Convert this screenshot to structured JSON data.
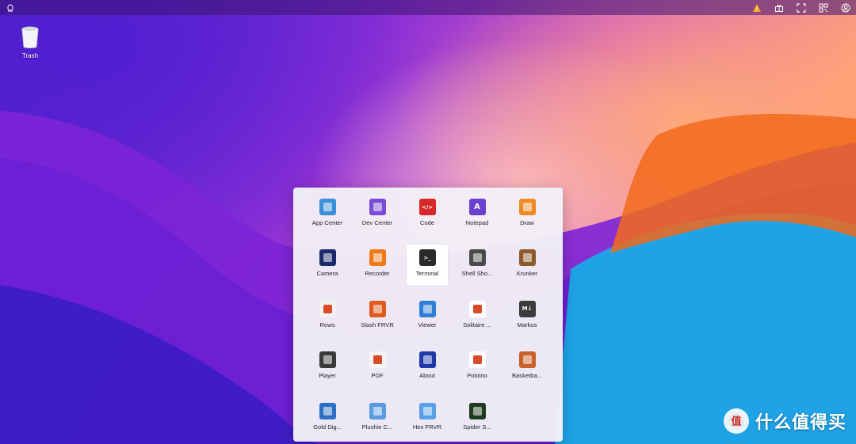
{
  "topbar": {
    "left_icon": "os-logo-icon",
    "right_icons": [
      "warning-icon",
      "gift-icon",
      "fullscreen-icon",
      "qr-code-icon",
      "user-icon"
    ]
  },
  "desktop": {
    "icons": [
      {
        "label": "Trash",
        "icon": "trash-icon"
      }
    ]
  },
  "launcher": {
    "apps": [
      {
        "label": "App Center",
        "icon": "app-center-icon",
        "color": "#3a8fd8"
      },
      {
        "label": "Dev Center",
        "icon": "dev-center-icon",
        "color": "#7a4bd6"
      },
      {
        "label": "Code",
        "icon": "code-icon",
        "color": "#d62828",
        "glyph": "</>"
      },
      {
        "label": "Notepad",
        "icon": "notepad-icon",
        "color": "#6b3fd0",
        "glyph": "A"
      },
      {
        "label": "Draw",
        "icon": "draw-icon",
        "color": "#f08a24"
      },
      {
        "label": "Camera",
        "icon": "camera-icon",
        "color": "#1b2a6b"
      },
      {
        "label": "Recorder",
        "icon": "recorder-icon",
        "color": "#f07a1a"
      },
      {
        "label": "Terminal",
        "icon": "terminal-icon",
        "color": "#2b2b2b",
        "glyph": ">_"
      },
      {
        "label": "Shell Sho...",
        "icon": "shell-shockers-icon",
        "color": "#4a4a4a"
      },
      {
        "label": "Krunker",
        "icon": "krunker-icon",
        "color": "#8a5a2a"
      },
      {
        "label": "Rows",
        "icon": "rows-icon",
        "color": "#f1f1f1"
      },
      {
        "label": "Slash FRVR",
        "icon": "slash-frvr-icon",
        "color": "#e05a1c"
      },
      {
        "label": "Viewer",
        "icon": "viewer-icon",
        "color": "#2f7fd8"
      },
      {
        "label": "Solitaire ...",
        "icon": "solitaire-icon",
        "color": "#ffffff"
      },
      {
        "label": "Markus",
        "icon": "markus-icon",
        "color": "#3b3b3b",
        "glyph": "M↓"
      },
      {
        "label": "Player",
        "icon": "player-icon",
        "color": "#3a3a3a"
      },
      {
        "label": "PDF",
        "icon": "pdf-icon",
        "color": "#f4f4f4"
      },
      {
        "label": "About",
        "icon": "about-icon",
        "color": "#1f3aa8"
      },
      {
        "label": "Polotno",
        "icon": "polotno-icon",
        "color": "#ffffff"
      },
      {
        "label": "Basketba...",
        "icon": "basketball-icon",
        "color": "#c8612a"
      },
      {
        "label": "Gold Dig...",
        "icon": "gold-digger-icon",
        "color": "#2d6fc4"
      },
      {
        "label": "Plushie C...",
        "icon": "plushie-icon",
        "color": "#5a9be0"
      },
      {
        "label": "Hex FRVR",
        "icon": "hex-frvr-icon",
        "color": "#5aa0e8"
      },
      {
        "label": "Spider S...",
        "icon": "spider-solitaire-icon",
        "color": "#1e3a1e"
      }
    ],
    "selected_index": 7
  },
  "watermark": {
    "text": "什么值得买",
    "icon": "zhi-logo-icon"
  }
}
